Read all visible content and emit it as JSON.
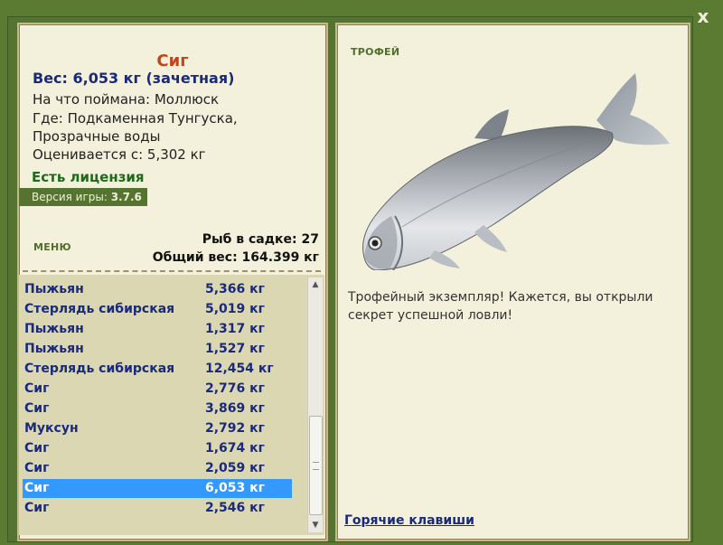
{
  "close_label": "x",
  "catch": {
    "name": "Сиг",
    "weight": "Вес: 6,053 кг (зачетная)",
    "bait": "На что поймана: Моллюск",
    "location_line1": "Где: Подкаменная Тунгуска,",
    "location_line2": "Прозрачные воды",
    "rated": "Оценивается с: 5,302 кг",
    "license": "Есть лицензия"
  },
  "version": {
    "label": "Версия игры:",
    "value": "3.7.6"
  },
  "menu_label": "МЕНЮ",
  "keepnet": {
    "count": "Рыб в садке: 27",
    "total": "Общий вес: 164.399 кг"
  },
  "fish_list": [
    {
      "name": "Пыжьян",
      "weight": "5,366 кг"
    },
    {
      "name": "Стерлядь сибирская",
      "weight": "5,019 кг"
    },
    {
      "name": "Пыжьян",
      "weight": "1,317 кг"
    },
    {
      "name": "Пыжьян",
      "weight": "1,527 кг"
    },
    {
      "name": "Стерлядь сибирская",
      "weight": "12,454 кг"
    },
    {
      "name": "Сиг",
      "weight": "2,776 кг"
    },
    {
      "name": "Сиг",
      "weight": "3,869 кг"
    },
    {
      "name": "Муксун",
      "weight": "2,792 кг"
    },
    {
      "name": "Сиг",
      "weight": "1,674 кг"
    },
    {
      "name": "Сиг",
      "weight": "2,059 кг"
    },
    {
      "name": "Сиг",
      "weight": "6,053 кг",
      "selected": true
    },
    {
      "name": "Сиг",
      "weight": "2,546 кг"
    }
  ],
  "trophy": {
    "title": "ТРОФЕЙ",
    "text": "Трофейный экземпляр! Кажется, вы открыли секрет успешной ловли!"
  },
  "hotkeys_label": "Горячие клавиши",
  "colors": {
    "frame": "#557331",
    "panel": "#f3f0db",
    "list_bg": "#dad7b2",
    "selected": "#3399ff",
    "fish_name": "#c4441a",
    "list_text": "#1a2a7a"
  }
}
